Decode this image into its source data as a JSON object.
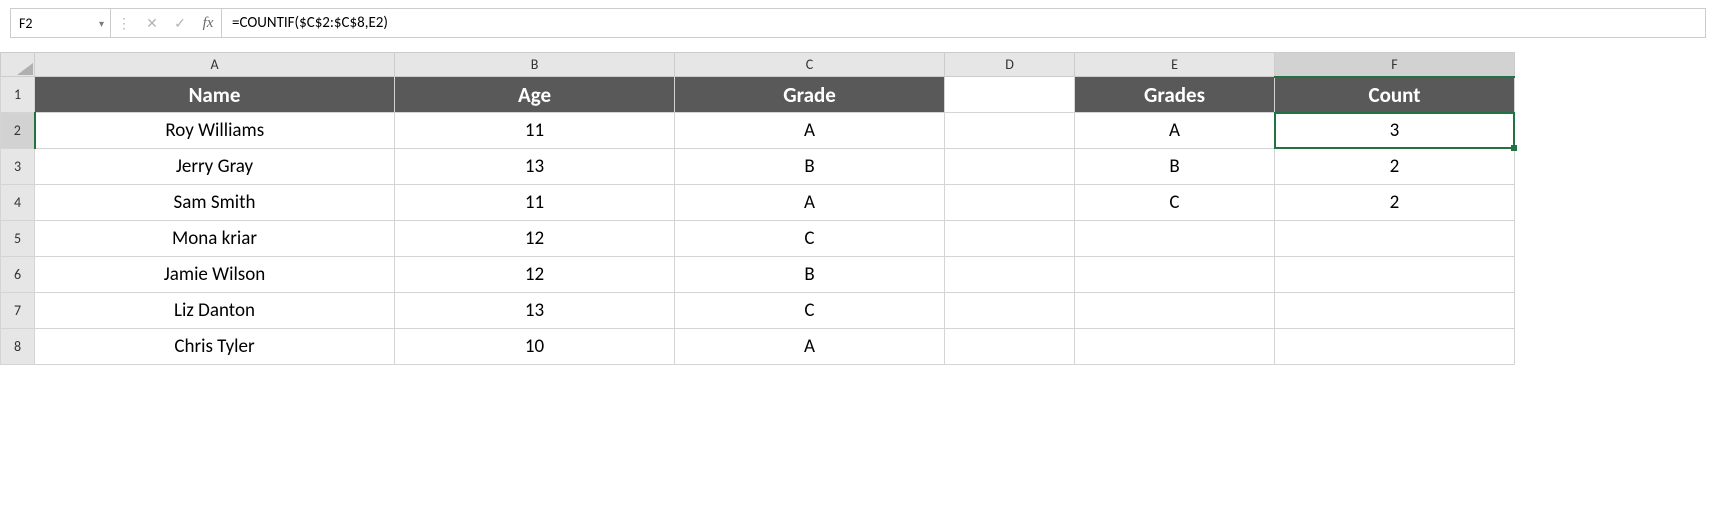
{
  "name_box": {
    "value": "F2"
  },
  "formula_bar": {
    "fx_label": "fx",
    "formula": "=COUNTIF($C$2:$C$8,E2)"
  },
  "columns": [
    "A",
    "B",
    "C",
    "D",
    "E",
    "F"
  ],
  "active_col": "F",
  "active_row": "2",
  "rows": [
    {
      "n": "1",
      "A": "Name",
      "B": "Age",
      "C": "Grade",
      "D": "",
      "E": "Grades",
      "F": "Count",
      "header": true
    },
    {
      "n": "2",
      "A": "Roy Williams",
      "B": "11",
      "C": "A",
      "D": "",
      "E": "A",
      "F": "3"
    },
    {
      "n": "3",
      "A": "Jerry Gray",
      "B": "13",
      "C": "B",
      "D": "",
      "E": "B",
      "F": "2"
    },
    {
      "n": "4",
      "A": "Sam Smith",
      "B": "11",
      "C": "A",
      "D": "",
      "E": "C",
      "F": "2"
    },
    {
      "n": "5",
      "A": "Mona kriar",
      "B": "12",
      "C": "C",
      "D": "",
      "E": "",
      "F": ""
    },
    {
      "n": "6",
      "A": "Jamie Wilson",
      "B": "12",
      "C": "B",
      "D": "",
      "E": "",
      "F": ""
    },
    {
      "n": "7",
      "A": "Liz Danton",
      "B": "13",
      "C": "C",
      "D": "",
      "E": "",
      "F": ""
    },
    {
      "n": "8",
      "A": "Chris Tyler",
      "B": "10",
      "C": "A",
      "D": "",
      "E": "",
      "F": ""
    }
  ]
}
